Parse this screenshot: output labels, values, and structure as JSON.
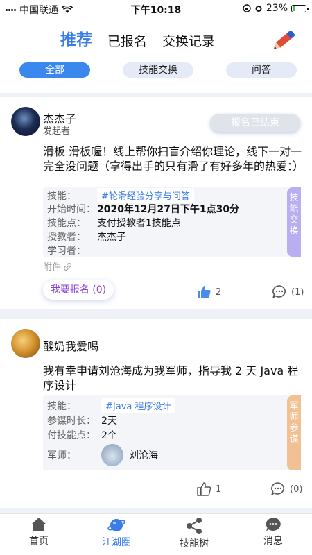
{
  "status_bar": {
    "carrier": "中国联通",
    "time": "下午10:18",
    "battery": "23%",
    "battery_level": 0.23
  },
  "header": {
    "tabs": [
      {
        "label": "推荐",
        "active": true
      },
      {
        "label": "已报名",
        "active": false
      },
      {
        "label": "交换记录",
        "active": false
      }
    ],
    "compose_icon": "pencil-icon"
  },
  "filters": [
    {
      "label": "全部",
      "active": true
    },
    {
      "label": "技能交换",
      "active": false
    },
    {
      "label": "问答",
      "active": false
    }
  ],
  "posts": [
    {
      "user": "杰杰子",
      "role": "发起者",
      "status": "报名已结束",
      "text": "滑板 滑板喔！线上帮你扫盲介绍你理论，线下一对一完全没问题（拿得出手的只有滑了有好多年的热爱：）",
      "details": {
        "skill_label": "技能：",
        "skill_tag": "#轮滑经验分享与问答",
        "start_label": "开始时间：",
        "start_value": "2020年12月27日下午1点30分",
        "points_label": "技能点：",
        "points_value": "支付授教者1技能点",
        "teacher_label": "授教者：",
        "teacher_value": "杰杰子",
        "learner_label": "学习者：",
        "learner_value": ""
      },
      "side_tab": "技能交换",
      "attachment": "附件",
      "signup_button": "我要报名 (0)",
      "likes": "2",
      "comments": "(1)"
    },
    {
      "user": "酸奶我爱喝",
      "text": "我有幸申请刘沧海成为我军师，指导我 2 天 Java 程序设计",
      "details": {
        "skill_label": "技能：",
        "skill_tag": "#Java 程序设计",
        "duration_label": "参谋时长：",
        "duration_value": "2天",
        "points_label": "付技能点：",
        "points_value": "2个",
        "advisor_label": "军师：",
        "advisor_value": "刘沧海"
      },
      "side_tab": "军师参谋",
      "likes": "1",
      "comments": "(0)"
    }
  ],
  "tabbar": [
    {
      "label": "首页",
      "icon": "home-icon",
      "active": false
    },
    {
      "label": "江湖圈",
      "icon": "planet-icon",
      "active": true
    },
    {
      "label": "技能树",
      "icon": "share-tree-icon",
      "active": false
    },
    {
      "label": "消息",
      "icon": "message-icon",
      "active": false
    }
  ],
  "colors": {
    "accent": "#3a7de6",
    "chip_active": "#3a88ee",
    "side_purple": "#b9aff0",
    "side_orange": "#f1c193",
    "signup_text": "#8b3fd6"
  }
}
